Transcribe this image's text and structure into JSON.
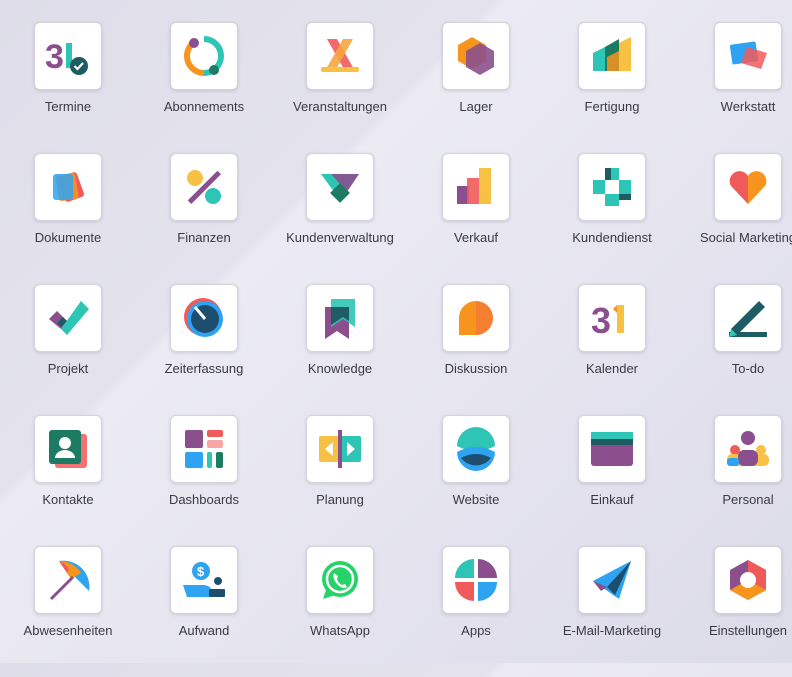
{
  "apps": [
    {
      "label": "Termine",
      "icon": "calendar-check-icon"
    },
    {
      "label": "Abonnements",
      "icon": "subscription-cycle-icon"
    },
    {
      "label": "Veranstaltungen",
      "icon": "event-icon"
    },
    {
      "label": "Lager",
      "icon": "inventory-hexagon-icon"
    },
    {
      "label": "Fertigung",
      "icon": "manufacturing-icon"
    },
    {
      "label": "Werkstatt",
      "icon": "workshop-tablet-icon"
    },
    {
      "label": "Dokumente",
      "icon": "documents-icon"
    },
    {
      "label": "Finanzen",
      "icon": "percent-icon"
    },
    {
      "label": "Kundenverwaltung",
      "icon": "crm-icon"
    },
    {
      "label": "Verkauf",
      "icon": "sales-chart-icon"
    },
    {
      "label": "Kundendienst",
      "icon": "helpdesk-cross-icon"
    },
    {
      "label": "Social Marketing",
      "icon": "heart-icon"
    },
    {
      "label": "Projekt",
      "icon": "checkmark-icon"
    },
    {
      "label": "Zeiterfassung",
      "icon": "timer-icon"
    },
    {
      "label": "Knowledge",
      "icon": "bookmark-icon"
    },
    {
      "label": "Diskussion",
      "icon": "chat-bubble-icon"
    },
    {
      "label": "Kalender",
      "icon": "calendar-icon"
    },
    {
      "label": "To-do",
      "icon": "todo-pen-icon"
    },
    {
      "label": "Kontakte",
      "icon": "contact-card-icon"
    },
    {
      "label": "Dashboards",
      "icon": "dashboard-icon"
    },
    {
      "label": "Planung",
      "icon": "planning-icon"
    },
    {
      "label": "Website",
      "icon": "globe-icon"
    },
    {
      "label": "Einkauf",
      "icon": "credit-card-icon"
    },
    {
      "label": "Personal",
      "icon": "employees-icon"
    },
    {
      "label": "Abwesenheiten",
      "icon": "umbrella-icon"
    },
    {
      "label": "Aufwand",
      "icon": "expense-hand-icon"
    },
    {
      "label": "WhatsApp",
      "icon": "whatsapp-icon"
    },
    {
      "label": "Apps",
      "icon": "apps-circle-icon"
    },
    {
      "label": "E-Mail-Marketing",
      "icon": "paper-plane-icon"
    },
    {
      "label": "Einstellungen",
      "icon": "settings-hexagon-icon"
    }
  ]
}
